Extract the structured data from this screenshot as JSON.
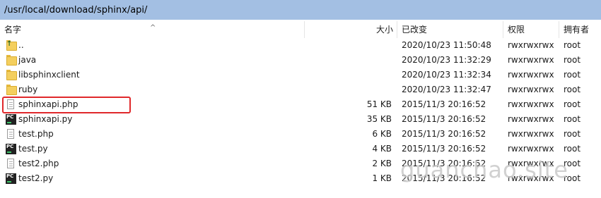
{
  "path": "/usr/local/download/sphinx/api/",
  "columns": {
    "name": "名字",
    "size": "大小",
    "modified": "已改变",
    "permissions": "权限",
    "owner": "拥有者"
  },
  "files": [
    {
      "name": "..",
      "type": "parent",
      "size": "",
      "modified": "2020/10/23 11:50:48",
      "permissions": "rwxrwxrwx",
      "owner": "root"
    },
    {
      "name": "java",
      "type": "folder",
      "size": "",
      "modified": "2020/10/23 11:32:29",
      "permissions": "rwxrwxrwx",
      "owner": "root"
    },
    {
      "name": "libsphinxclient",
      "type": "folder",
      "size": "",
      "modified": "2020/10/23 11:32:34",
      "permissions": "rwxrwxrwx",
      "owner": "root"
    },
    {
      "name": "ruby",
      "type": "folder",
      "size": "",
      "modified": "2020/10/23 11:32:47",
      "permissions": "rwxrwxrwx",
      "owner": "root"
    },
    {
      "name": "sphinxapi.php",
      "type": "file",
      "size": "51 KB",
      "modified": "2015/11/3 20:16:52",
      "permissions": "rwxrwxrwx",
      "owner": "root"
    },
    {
      "name": "sphinxapi.py",
      "type": "python",
      "size": "35 KB",
      "modified": "2015/11/3 20:16:52",
      "permissions": "rwxrwxrwx",
      "owner": "root"
    },
    {
      "name": "test.php",
      "type": "file",
      "size": "6 KB",
      "modified": "2015/11/3 20:16:52",
      "permissions": "rwxrwxrwx",
      "owner": "root"
    },
    {
      "name": "test.py",
      "type": "python",
      "size": "4 KB",
      "modified": "2015/11/3 20:16:52",
      "permissions": "rwxrwxrwx",
      "owner": "root"
    },
    {
      "name": "test2.php",
      "type": "file",
      "size": "2 KB",
      "modified": "2015/11/3 20:16:52",
      "permissions": "rwxrwxrwx",
      "owner": "root"
    },
    {
      "name": "test2.py",
      "type": "python",
      "size": "1 KB",
      "modified": "2015/11/3 20:16:52",
      "permissions": "rwxrwxrwx",
      "owner": "root"
    }
  ],
  "watermark": "guanchao.site",
  "colors": {
    "pathbar": "#a3bfe3",
    "highlight": "#e0282b"
  }
}
